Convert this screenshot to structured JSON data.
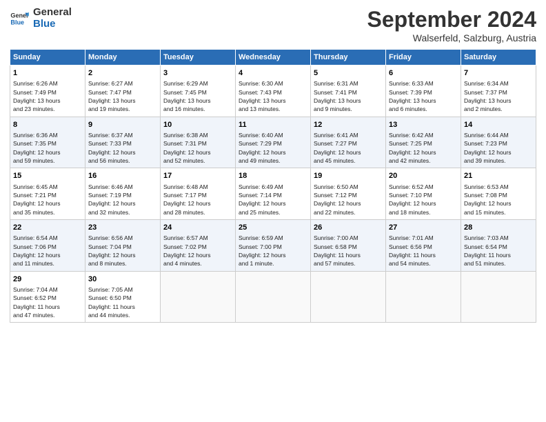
{
  "header": {
    "logo_line1": "General",
    "logo_line2": "Blue",
    "month": "September 2024",
    "location": "Walserfeld, Salzburg, Austria"
  },
  "columns": [
    "Sunday",
    "Monday",
    "Tuesday",
    "Wednesday",
    "Thursday",
    "Friday",
    "Saturday"
  ],
  "weeks": [
    [
      {
        "day": "1",
        "info": "Sunrise: 6:26 AM\nSunset: 7:49 PM\nDaylight: 13 hours\nand 23 minutes."
      },
      {
        "day": "2",
        "info": "Sunrise: 6:27 AM\nSunset: 7:47 PM\nDaylight: 13 hours\nand 19 minutes."
      },
      {
        "day": "3",
        "info": "Sunrise: 6:29 AM\nSunset: 7:45 PM\nDaylight: 13 hours\nand 16 minutes."
      },
      {
        "day": "4",
        "info": "Sunrise: 6:30 AM\nSunset: 7:43 PM\nDaylight: 13 hours\nand 13 minutes."
      },
      {
        "day": "5",
        "info": "Sunrise: 6:31 AM\nSunset: 7:41 PM\nDaylight: 13 hours\nand 9 minutes."
      },
      {
        "day": "6",
        "info": "Sunrise: 6:33 AM\nSunset: 7:39 PM\nDaylight: 13 hours\nand 6 minutes."
      },
      {
        "day": "7",
        "info": "Sunrise: 6:34 AM\nSunset: 7:37 PM\nDaylight: 13 hours\nand 2 minutes."
      }
    ],
    [
      {
        "day": "8",
        "info": "Sunrise: 6:36 AM\nSunset: 7:35 PM\nDaylight: 12 hours\nand 59 minutes."
      },
      {
        "day": "9",
        "info": "Sunrise: 6:37 AM\nSunset: 7:33 PM\nDaylight: 12 hours\nand 56 minutes."
      },
      {
        "day": "10",
        "info": "Sunrise: 6:38 AM\nSunset: 7:31 PM\nDaylight: 12 hours\nand 52 minutes."
      },
      {
        "day": "11",
        "info": "Sunrise: 6:40 AM\nSunset: 7:29 PM\nDaylight: 12 hours\nand 49 minutes."
      },
      {
        "day": "12",
        "info": "Sunrise: 6:41 AM\nSunset: 7:27 PM\nDaylight: 12 hours\nand 45 minutes."
      },
      {
        "day": "13",
        "info": "Sunrise: 6:42 AM\nSunset: 7:25 PM\nDaylight: 12 hours\nand 42 minutes."
      },
      {
        "day": "14",
        "info": "Sunrise: 6:44 AM\nSunset: 7:23 PM\nDaylight: 12 hours\nand 39 minutes."
      }
    ],
    [
      {
        "day": "15",
        "info": "Sunrise: 6:45 AM\nSunset: 7:21 PM\nDaylight: 12 hours\nand 35 minutes."
      },
      {
        "day": "16",
        "info": "Sunrise: 6:46 AM\nSunset: 7:19 PM\nDaylight: 12 hours\nand 32 minutes."
      },
      {
        "day": "17",
        "info": "Sunrise: 6:48 AM\nSunset: 7:17 PM\nDaylight: 12 hours\nand 28 minutes."
      },
      {
        "day": "18",
        "info": "Sunrise: 6:49 AM\nSunset: 7:14 PM\nDaylight: 12 hours\nand 25 minutes."
      },
      {
        "day": "19",
        "info": "Sunrise: 6:50 AM\nSunset: 7:12 PM\nDaylight: 12 hours\nand 22 minutes."
      },
      {
        "day": "20",
        "info": "Sunrise: 6:52 AM\nSunset: 7:10 PM\nDaylight: 12 hours\nand 18 minutes."
      },
      {
        "day": "21",
        "info": "Sunrise: 6:53 AM\nSunset: 7:08 PM\nDaylight: 12 hours\nand 15 minutes."
      }
    ],
    [
      {
        "day": "22",
        "info": "Sunrise: 6:54 AM\nSunset: 7:06 PM\nDaylight: 12 hours\nand 11 minutes."
      },
      {
        "day": "23",
        "info": "Sunrise: 6:56 AM\nSunset: 7:04 PM\nDaylight: 12 hours\nand 8 minutes."
      },
      {
        "day": "24",
        "info": "Sunrise: 6:57 AM\nSunset: 7:02 PM\nDaylight: 12 hours\nand 4 minutes."
      },
      {
        "day": "25",
        "info": "Sunrise: 6:59 AM\nSunset: 7:00 PM\nDaylight: 12 hours\nand 1 minute."
      },
      {
        "day": "26",
        "info": "Sunrise: 7:00 AM\nSunset: 6:58 PM\nDaylight: 11 hours\nand 57 minutes."
      },
      {
        "day": "27",
        "info": "Sunrise: 7:01 AM\nSunset: 6:56 PM\nDaylight: 11 hours\nand 54 minutes."
      },
      {
        "day": "28",
        "info": "Sunrise: 7:03 AM\nSunset: 6:54 PM\nDaylight: 11 hours\nand 51 minutes."
      }
    ],
    [
      {
        "day": "29",
        "info": "Sunrise: 7:04 AM\nSunset: 6:52 PM\nDaylight: 11 hours\nand 47 minutes."
      },
      {
        "day": "30",
        "info": "Sunrise: 7:05 AM\nSunset: 6:50 PM\nDaylight: 11 hours\nand 44 minutes."
      },
      {
        "day": "",
        "info": ""
      },
      {
        "day": "",
        "info": ""
      },
      {
        "day": "",
        "info": ""
      },
      {
        "day": "",
        "info": ""
      },
      {
        "day": "",
        "info": ""
      }
    ]
  ]
}
